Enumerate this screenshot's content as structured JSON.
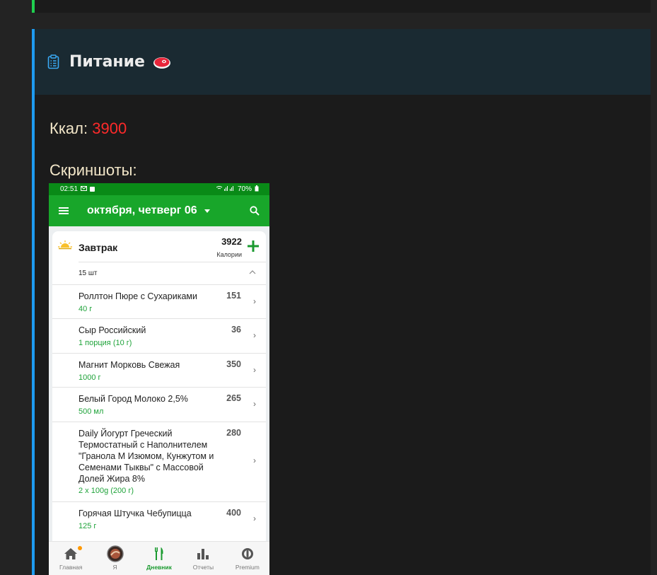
{
  "callout": {
    "title": "Питание",
    "kcal_label": "Ккал:",
    "kcal_value": "3900",
    "screenshots_label": "Скриншоты:"
  },
  "phone": {
    "status": {
      "time": "02:51",
      "battery": "70%"
    },
    "appbar": {
      "date": "октября, четверг 06"
    },
    "meal": {
      "title": "Завтрак",
      "calories": "3922",
      "calories_label": "Калории",
      "count": "15 шт"
    },
    "items": [
      {
        "name": "Роллтон Пюре с Сухариками",
        "amount": "40 г",
        "cal": "151"
      },
      {
        "name": "Сыр Российский",
        "amount": "1 порция (10 г)",
        "cal": "36"
      },
      {
        "name": "Магнит Морковь Свежая",
        "amount": "1000 г",
        "cal": "350"
      },
      {
        "name": "Белый Город Молоко 2,5%",
        "amount": "500 мл",
        "cal": "265"
      },
      {
        "name": "Daily Йогурт Греческий Термостатный с Наполнителем \"Гранола М Изюмом, Кунжутом и Семенами Тыквы\" с Массовой Долей Жира 8%",
        "amount": "2 x 100g (200 г)",
        "cal": "280"
      },
      {
        "name": "Горячая Штучка Чебупицца",
        "amount": "125 г",
        "cal": "400"
      }
    ],
    "nav": [
      {
        "label": "Главная"
      },
      {
        "label": "Я"
      },
      {
        "label": "Дневник"
      },
      {
        "label": "Отчеты"
      },
      {
        "label": "Premium"
      }
    ]
  },
  "colors": {
    "accent_green": "#18a62a",
    "kcal_red": "#ff2a2a",
    "callout_blue": "#1e9bf0"
  }
}
